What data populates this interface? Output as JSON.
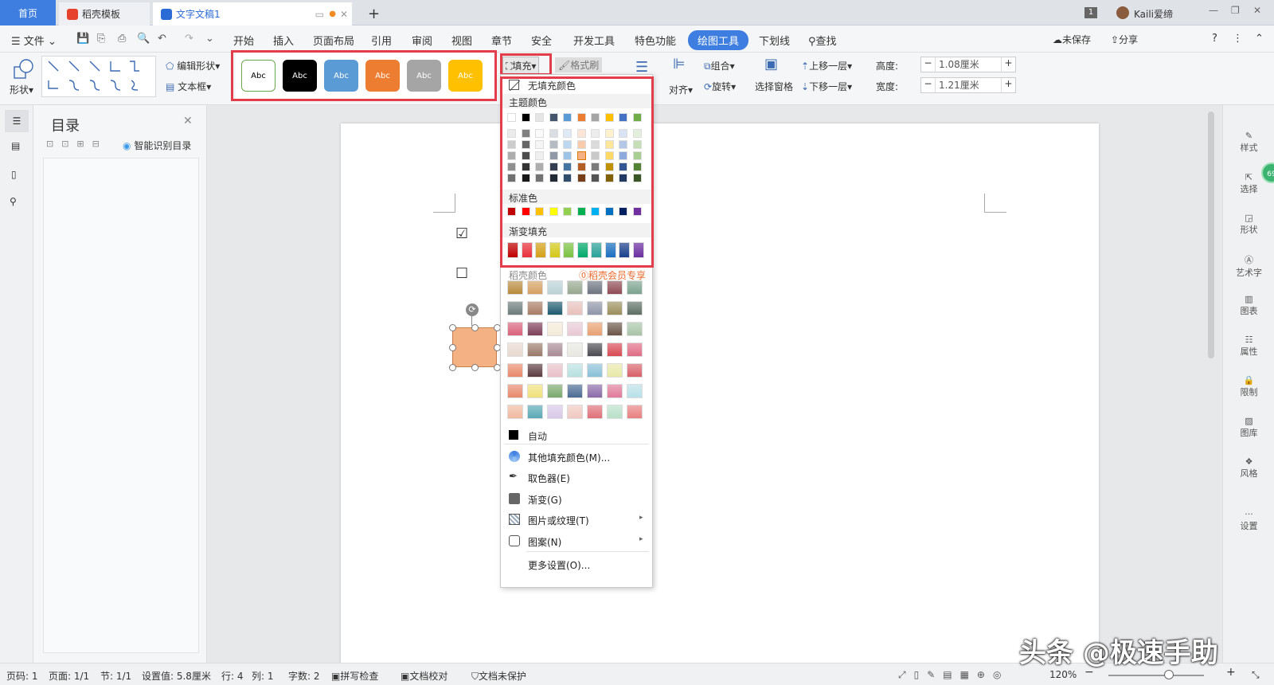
{
  "tabs": {
    "home": "首页",
    "template": "稻壳模板",
    "doc": "文字文稿1",
    "add": "+"
  },
  "titlebar": {
    "page_badge": "1",
    "user": "Kaili爱缔"
  },
  "menu": {
    "file": "文件",
    "items": [
      "开始",
      "插入",
      "页面布局",
      "引用",
      "审阅",
      "视图",
      "章节",
      "安全",
      "开发工具",
      "特色功能",
      "绘图工具",
      "下划线"
    ],
    "search": "查找",
    "unsaved": "未保存",
    "share": "分享"
  },
  "ribbon": {
    "shape": "形状",
    "edit_shape": "编辑形状",
    "textbox": "文本框",
    "style_label": "Abc",
    "fill": "填充",
    "format_painter": "格式刷",
    "align": "对齐",
    "group": "组合",
    "rotate": "旋转",
    "selection_pane": "选择窗格",
    "bring_forward": "上移一层",
    "send_backward": "下移一层",
    "height_label": "高度:",
    "height_value": "1.08厘米",
    "width_label": "宽度:",
    "width_value": "1.21厘米",
    "minus": "−",
    "plus": "+"
  },
  "shape_styles": [
    {
      "bg": "#ffffff",
      "border": "#6aa84f",
      "color": "#000"
    },
    {
      "bg": "#000000",
      "border": "#000",
      "color": "#fff"
    },
    {
      "bg": "#5b9bd5",
      "border": "#5b9bd5",
      "color": "#fff"
    },
    {
      "bg": "#ed7d31",
      "border": "#ed7d31",
      "color": "#fff"
    },
    {
      "bg": "#a5a5a5",
      "border": "#a5a5a5",
      "color": "#fff"
    },
    {
      "bg": "#ffc000",
      "border": "#ffc000",
      "color": "#fff"
    }
  ],
  "toc": {
    "title": "目录",
    "smart": "智能识别目录"
  },
  "dropdown": {
    "no_fill": "无填充颜色",
    "theme_colors": "主题颜色",
    "standard_colors": "标准色",
    "gradient_fill": "渐变填充",
    "docer_colors": "稻壳颜色",
    "docer_member": "稻壳会员专享",
    "auto": "自动",
    "items": [
      {
        "label": "其他填充颜色(M)...",
        "icon": "palette-icon"
      },
      {
        "label": "取色器(E)",
        "icon": "eyedropper-icon"
      },
      {
        "label": "渐变(G)",
        "icon": "gradient-icon"
      },
      {
        "label": "图片或纹理(T)",
        "icon": "picture-icon"
      },
      {
        "label": "图案(N)",
        "icon": "pattern-icon"
      },
      {
        "label": "更多设置(O)...",
        "icon": ""
      }
    ],
    "theme_top": [
      "#ffffff",
      "#000000",
      "#e7e6e6",
      "#44546a",
      "#5b9bd5",
      "#ed7d31",
      "#a5a5a5",
      "#ffc000",
      "#4472c4",
      "#70ad47"
    ],
    "standard": [
      "#c00000",
      "#ff0000",
      "#ffc000",
      "#ffff00",
      "#92d050",
      "#00b050",
      "#00b0f0",
      "#0070c0",
      "#002060",
      "#7030a0"
    ],
    "gradient": [
      "#c00000",
      "#e8303a",
      "#d4a017",
      "#d4c817",
      "#7cc242",
      "#00a86b",
      "#2aa198",
      "#1a6fc0",
      "#1a3f8c",
      "#6a2fa0"
    ]
  },
  "rightbar": [
    "样式",
    "选择",
    "形状",
    "艺术字",
    "图表",
    "属性",
    "限制",
    "图库",
    "风格",
    "设置"
  ],
  "status": {
    "page": "页码: 1",
    "pages": "页面: 1/1",
    "section": "节: 1/1",
    "setting": "设置值: 5.8厘米",
    "row": "行: 4",
    "col": "列: 1",
    "words": "字数: 2",
    "spell": "拼写检查",
    "proof": "文档校对",
    "protect": "文档未保护",
    "zoom": "120%"
  },
  "watermark": "头条 @极速手助",
  "badge_num": "69"
}
